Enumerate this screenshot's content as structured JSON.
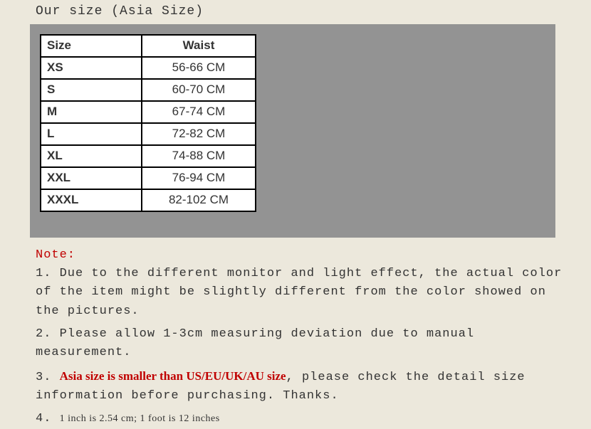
{
  "title": "Our size (Asia Size)",
  "table": {
    "headers": {
      "size": "Size",
      "waist": "Waist"
    },
    "rows": [
      {
        "size": "XS",
        "waist": "56-66 CM"
      },
      {
        "size": "S",
        "waist": "60-70 CM"
      },
      {
        "size": "M",
        "waist": "67-74 CM"
      },
      {
        "size": "L",
        "waist": "72-82 CM"
      },
      {
        "size": "XL",
        "waist": "74-88 CM"
      },
      {
        "size": "XXL",
        "waist": "76-94 CM"
      },
      {
        "size": "XXXL",
        "waist": "82-102 CM"
      }
    ]
  },
  "notes": {
    "label": "Note:",
    "n1": "1. Due to the different monitor and light effect, the actual color of the item might be slightly different from the color showed on the pictures.",
    "n2": "2. Please allow 1-3cm measuring deviation due to manual measurement.",
    "n3_prefix": "3. ",
    "n3_warn": "Asia size is smaller than US/EU/UK/AU size",
    "n3_rest": ", please check the detail size information before purchasing. Thanks.",
    "n4_prefix": "4.  ",
    "n4_text": "1 inch is 2.54 cm; 1 foot  is 12 inches"
  },
  "chart_data": {
    "type": "table",
    "title": "Our size (Asia Size)",
    "columns": [
      "Size",
      "Waist"
    ],
    "rows": [
      [
        "XS",
        "56-66 CM"
      ],
      [
        "S",
        "60-70 CM"
      ],
      [
        "M",
        "67-74 CM"
      ],
      [
        "L",
        "72-82 CM"
      ],
      [
        "XL",
        "74-88 CM"
      ],
      [
        "XXL",
        "76-94 CM"
      ],
      [
        "XXXL",
        "82-102 CM"
      ]
    ]
  }
}
